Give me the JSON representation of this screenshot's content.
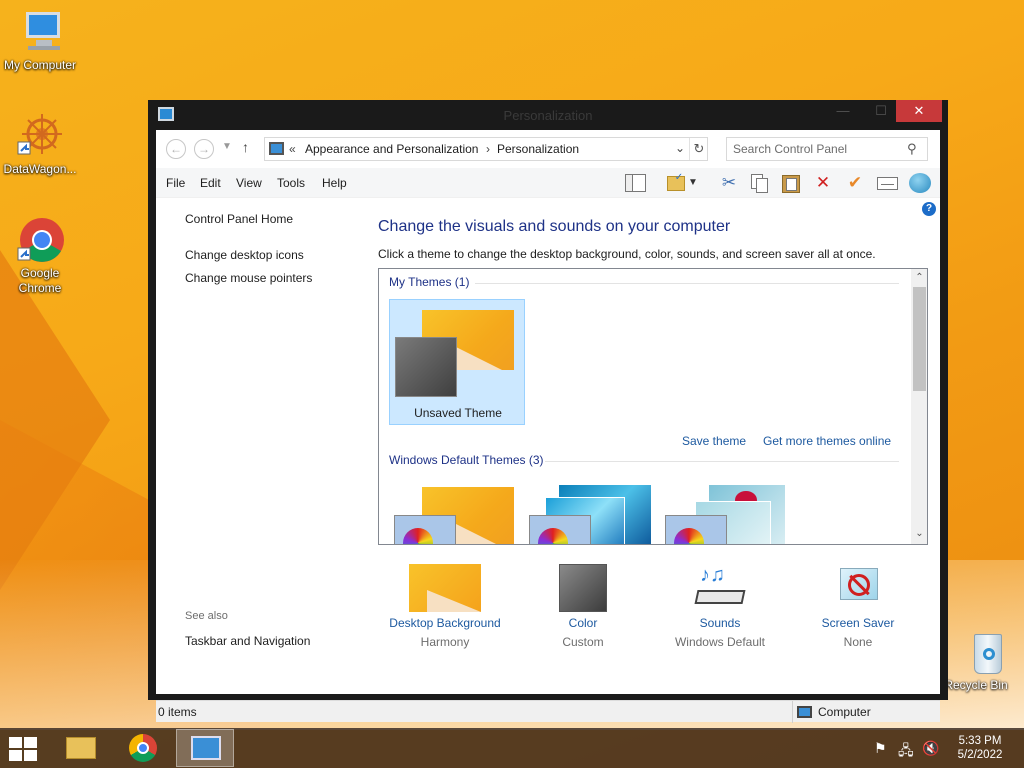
{
  "desktop": {
    "icons": [
      {
        "label": "My Computer"
      },
      {
        "label": "DataWagon..."
      },
      {
        "label": "Google Chrome"
      },
      {
        "label": "Recycle Bin"
      }
    ]
  },
  "window": {
    "title": "Personalization",
    "address": {
      "chevrons": "«",
      "crumbs": [
        "Appearance and Personalization",
        "Personalization"
      ],
      "separator": "›"
    },
    "search": {
      "placeholder": "Search Control Panel"
    },
    "menu": [
      "File",
      "Edit",
      "View",
      "Tools",
      "Help"
    ],
    "toolbar_icons": [
      "layout-icon",
      "folder-check-icon",
      "cut-icon",
      "copy-icon",
      "paste-icon",
      "delete-icon",
      "check-icon",
      "properties-icon",
      "globe-icon"
    ],
    "help_glyph": "?",
    "left_pane": {
      "links": [
        "Control Panel Home",
        "Change desktop icons",
        "Change mouse pointers"
      ],
      "see_also": "See also",
      "see_also_links": [
        "Taskbar and Navigation"
      ]
    },
    "main": {
      "heading": "Change the visuals and sounds on your computer",
      "subtext": "Click a theme to change the desktop background, color, sounds, and screen saver all at once.",
      "my_themes_title": "My Themes (1)",
      "my_themes": [
        {
          "name": "Unsaved Theme"
        }
      ],
      "save_theme": "Save theme",
      "get_more": "Get more themes online",
      "default_themes_title": "Windows Default Themes (3)"
    },
    "bottom": [
      {
        "link": "Desktop Background",
        "sub": "Harmony"
      },
      {
        "link": "Color",
        "sub": "Custom"
      },
      {
        "link": "Sounds",
        "sub": "Windows Default"
      },
      {
        "link": "Screen Saver",
        "sub": "None"
      }
    ],
    "status": {
      "items": "0 items",
      "zone": "Computer"
    }
  },
  "taskbar": {
    "clock_time": "5:33 PM",
    "clock_date": "5/2/2022"
  },
  "colors": {
    "link": "#1e5aa0",
    "heading": "#1e3287",
    "close": "#c7393a",
    "selection": "#cce8ff"
  }
}
